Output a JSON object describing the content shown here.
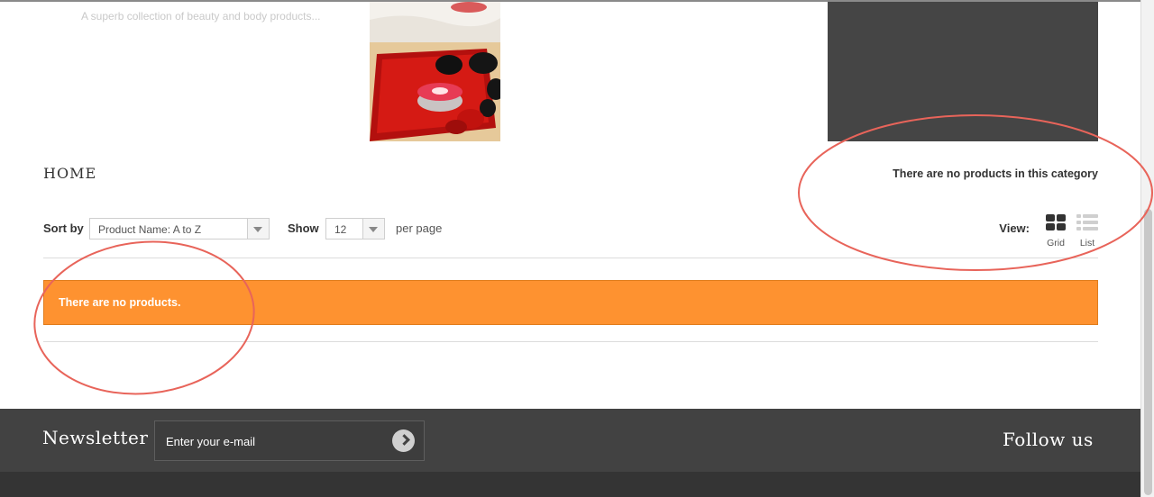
{
  "header": {
    "tagline": "A superb collection of beauty and body products..."
  },
  "breadcrumb": {
    "home": "HOME"
  },
  "category_message": "There are no products in this category",
  "toolbar": {
    "sort_label": "Sort by",
    "sort_value": "Product Name: A to Z",
    "show_label": "Show",
    "show_value": "12",
    "per_page": "per page",
    "view_label": "View:",
    "grid_label": "Grid",
    "list_label": "List"
  },
  "alert": {
    "text": "There are no products.",
    "color": "#fe9230"
  },
  "footer": {
    "newsletter_title": "Newsletter",
    "newsletter_placeholder": "Enter your e-mail",
    "follow_title": "Follow us"
  },
  "icons": {
    "submit": "arrow-right-circle-icon",
    "grid": "grid-view-icon",
    "list": "list-view-icon",
    "select_arrow": "chevron-down-icon"
  },
  "annotation_color": "#e8645a"
}
